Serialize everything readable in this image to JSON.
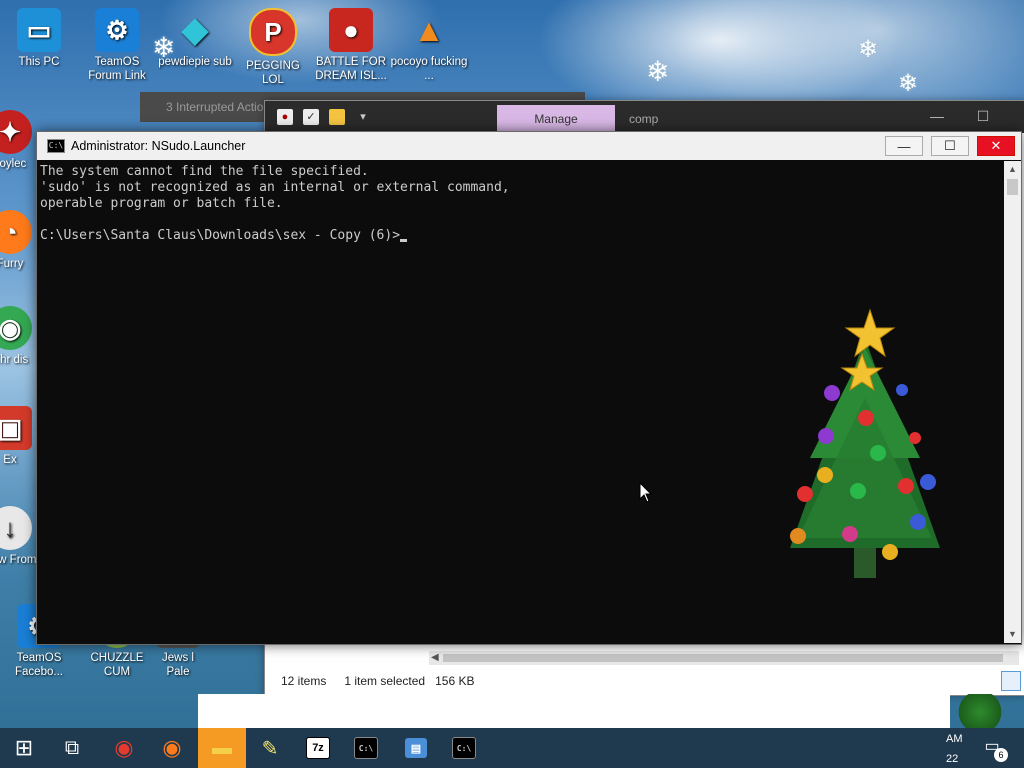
{
  "desktop_icons": [
    {
      "label": "This PC",
      "icon": "this-pc-icon",
      "color": "#1e90d8"
    },
    {
      "label": "TeamOS Forum Link",
      "icon": "gear-icon",
      "color": "#1a7fd6"
    },
    {
      "label": "pewdiepie sub",
      "icon": "diamond-icon",
      "color": "#2fc4d8"
    },
    {
      "label": "PEGGING LOL",
      "icon": "p-icon",
      "color": "#d9362b"
    },
    {
      "label": "BATTLE FOR DREAM ISL...",
      "icon": "angry-bird-icon",
      "color": "#c7271f"
    },
    {
      "label": "pocoyo fucking ...",
      "icon": "vlc-cone-icon",
      "color": "#f28b1e"
    },
    {
      "label": "yoylec",
      "icon": "ornament-icon",
      "color": "#c42020"
    },
    {
      "label": "Furry",
      "icon": "firefox-icon",
      "color": "#ff7a1a"
    },
    {
      "label": "Chr dis",
      "icon": "chrome-icon",
      "color": "#34a853"
    },
    {
      "label": "Ex",
      "icon": "gift-icon",
      "color": "#d43a2a"
    },
    {
      "label": "Dow From",
      "icon": "download-icon",
      "color": "#e8e8e8"
    },
    {
      "label": "TeamOS Facebo...",
      "icon": "gear-icon",
      "color": "#1a7fd6"
    },
    {
      "label": "CHUZZLE CUM",
      "icon": "chuzzle-icon",
      "color": "#8bc34a"
    },
    {
      "label": "Jews l Pale",
      "icon": "folder-icon",
      "color": "#555555"
    }
  ],
  "ghost_window": {
    "title": "3 Interrupted Actio"
  },
  "explorer": {
    "tab_manage": "Manage",
    "tab_comp": "comp",
    "status_items": "12 items",
    "status_selected": "1 item selected",
    "status_size": "156 KB"
  },
  "console": {
    "title": "Administrator: NSudo.Launcher",
    "icon_text": "C:\\",
    "lines": [
      "The system cannot find the file specified.",
      "'sudo' is not recognized as an internal or external command,",
      "operable program or batch file.",
      "",
      "C:\\Users\\Santa Claus\\Downloads\\sex - Copy (6)>"
    ],
    "minimize": "—",
    "maximize": "☐",
    "close": "✕"
  },
  "taskbar": {
    "clock_line1": "AM",
    "clock_line2": "22",
    "notification_count": "6",
    "items": [
      {
        "name": "start-button",
        "glyph": "⊞",
        "color": "#ffffff"
      },
      {
        "name": "task-view-button",
        "glyph": "⧉",
        "color": "#ffffff"
      },
      {
        "name": "chrome-taskbar",
        "glyph": "◉",
        "color": "#e33b2e"
      },
      {
        "name": "firefox-taskbar",
        "glyph": "◉",
        "color": "#ff7a1a"
      },
      {
        "name": "file-explorer-taskbar",
        "glyph": "▬",
        "color": "#f5c542"
      },
      {
        "name": "notepad-taskbar",
        "glyph": "✎",
        "color": "#f0e070"
      },
      {
        "name": "sevenzip-taskbar",
        "glyph": "7z",
        "color": "#ffffff"
      },
      {
        "name": "console-taskbar-1",
        "glyph": "C:\\",
        "color": "#000000"
      },
      {
        "name": "control-panel-taskbar",
        "glyph": "▤",
        "color": "#4a8fd8"
      },
      {
        "name": "console-taskbar-2",
        "glyph": "C:\\",
        "color": "#000000"
      }
    ]
  }
}
